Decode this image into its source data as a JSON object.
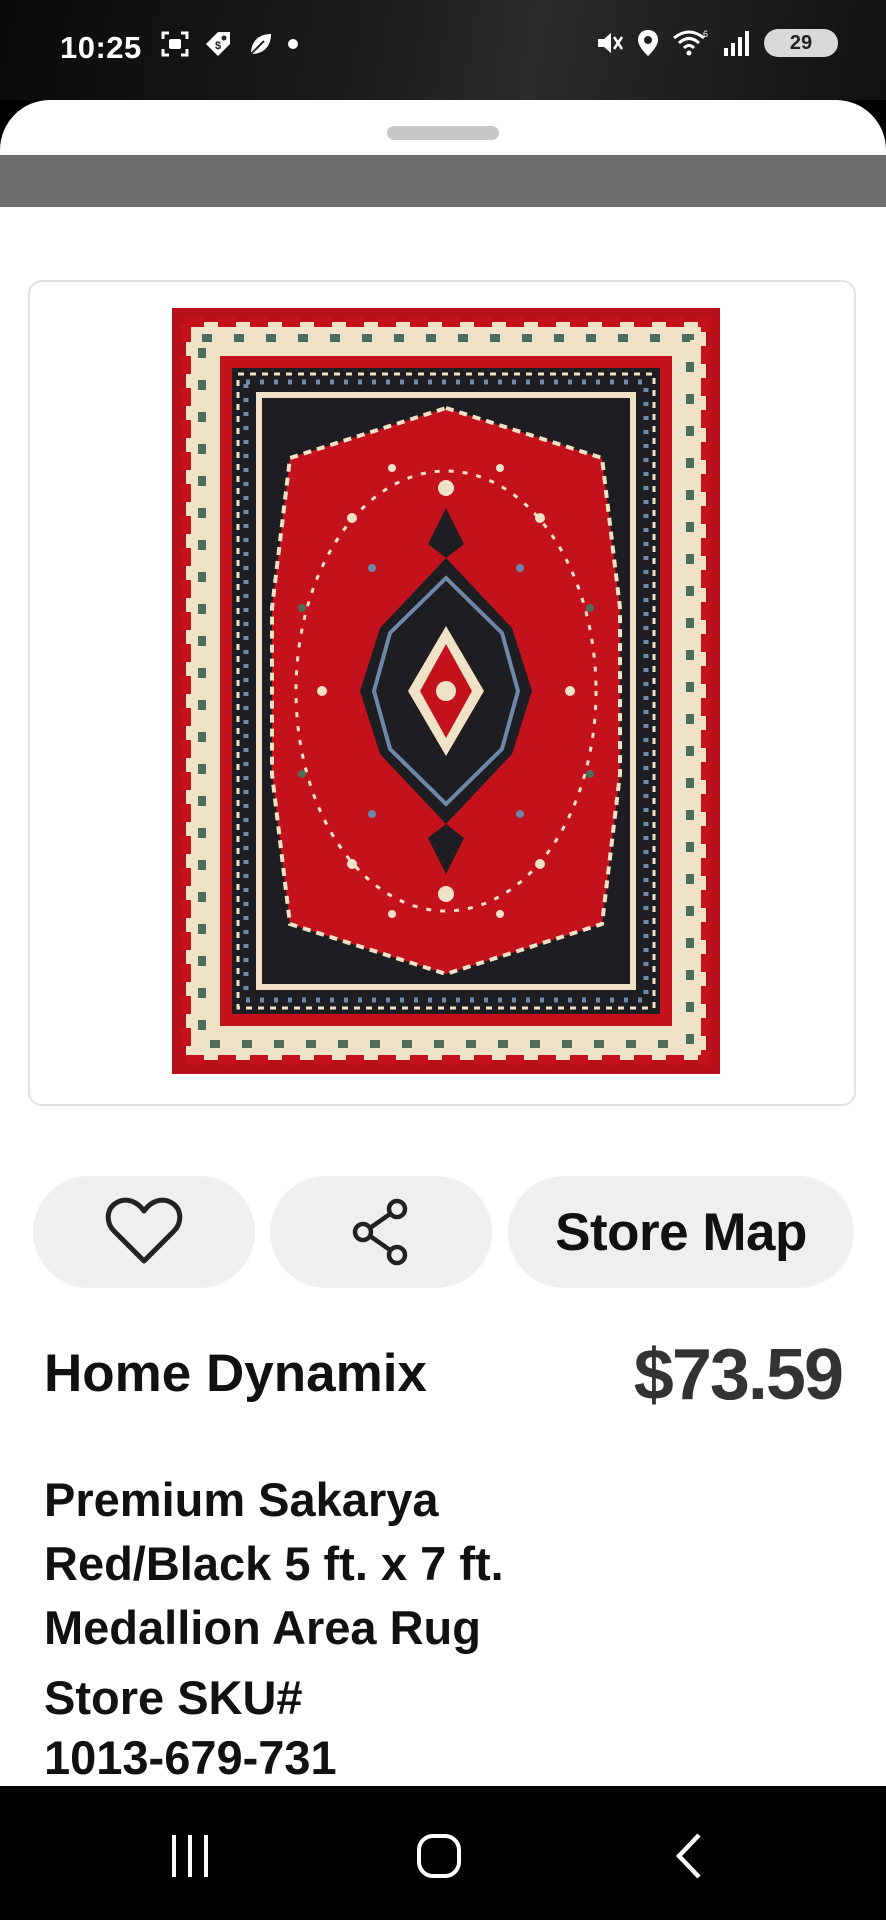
{
  "status_bar": {
    "time": "10:25",
    "battery": "29",
    "left_icons": [
      "screenshot-icon",
      "shopping-tag-icon",
      "leaf-icon",
      "notification-dot-icon"
    ],
    "right_icons": [
      "mute-vibrate-icon",
      "location-icon",
      "wifi-icon",
      "signal-icon",
      "battery-icon"
    ]
  },
  "product": {
    "image_alt": "red rug with black medallion",
    "brand": "Home Dynamix",
    "price": "$73.59",
    "title_lines": [
      "Premium Sakarya",
      "Red/Black 5 ft. x 7 ft.",
      "Medallion Area Rug"
    ],
    "sku_label": "Store SKU#",
    "sku_number": "1013-679-731"
  },
  "actions": {
    "favorite_icon": "heart-icon",
    "share_icon": "share-icon",
    "store_map_label": "Store Map"
  },
  "colors": {
    "rug_red": "#c4121c",
    "rug_cream": "#efe2c7",
    "rug_black": "#1e1e22",
    "button_bg": "#efefef"
  },
  "nav_bar": {
    "buttons": [
      "recent-apps-icon",
      "home-icon",
      "back-icon"
    ]
  }
}
